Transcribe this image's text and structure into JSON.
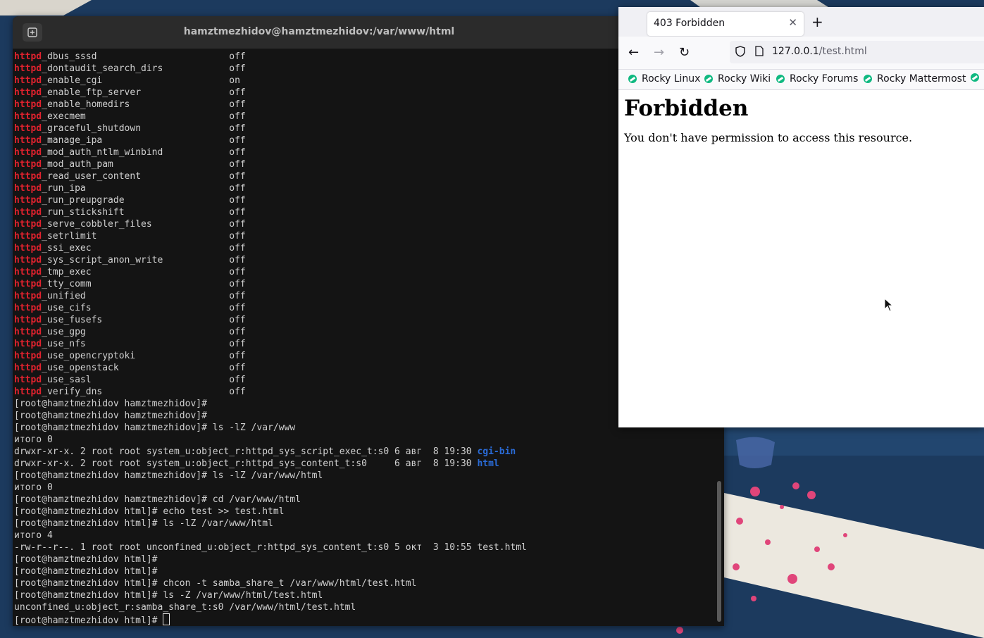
{
  "terminal": {
    "title": "hamztmezhidov@hamztmezhidov:/var/www/html",
    "lines": [
      [
        {
          "t": "httpd",
          "c": "red"
        },
        {
          "t": "_dbus_sssd                        off"
        }
      ],
      [
        {
          "t": "httpd",
          "c": "red"
        },
        {
          "t": "_dontaudit_search_dirs            off"
        }
      ],
      [
        {
          "t": "httpd",
          "c": "red"
        },
        {
          "t": "_enable_cgi                       on"
        }
      ],
      [
        {
          "t": "httpd",
          "c": "red"
        },
        {
          "t": "_enable_ftp_server                off"
        }
      ],
      [
        {
          "t": "httpd",
          "c": "red"
        },
        {
          "t": "_enable_homedirs                  off"
        }
      ],
      [
        {
          "t": "httpd",
          "c": "red"
        },
        {
          "t": "_execmem                          off"
        }
      ],
      [
        {
          "t": "httpd",
          "c": "red"
        },
        {
          "t": "_graceful_shutdown                off"
        }
      ],
      [
        {
          "t": "httpd",
          "c": "red"
        },
        {
          "t": "_manage_ipa                       off"
        }
      ],
      [
        {
          "t": "httpd",
          "c": "red"
        },
        {
          "t": "_mod_auth_ntlm_winbind            off"
        }
      ],
      [
        {
          "t": "httpd",
          "c": "red"
        },
        {
          "t": "_mod_auth_pam                     off"
        }
      ],
      [
        {
          "t": "httpd",
          "c": "red"
        },
        {
          "t": "_read_user_content                off"
        }
      ],
      [
        {
          "t": "httpd",
          "c": "red"
        },
        {
          "t": "_run_ipa                          off"
        }
      ],
      [
        {
          "t": "httpd",
          "c": "red"
        },
        {
          "t": "_run_preupgrade                   off"
        }
      ],
      [
        {
          "t": "httpd",
          "c": "red"
        },
        {
          "t": "_run_stickshift                   off"
        }
      ],
      [
        {
          "t": "httpd",
          "c": "red"
        },
        {
          "t": "_serve_cobbler_files              off"
        }
      ],
      [
        {
          "t": "httpd",
          "c": "red"
        },
        {
          "t": "_setrlimit                        off"
        }
      ],
      [
        {
          "t": "httpd",
          "c": "red"
        },
        {
          "t": "_ssi_exec                         off"
        }
      ],
      [
        {
          "t": "httpd",
          "c": "red"
        },
        {
          "t": "_sys_script_anon_write            off"
        }
      ],
      [
        {
          "t": "httpd",
          "c": "red"
        },
        {
          "t": "_tmp_exec                         off"
        }
      ],
      [
        {
          "t": "httpd",
          "c": "red"
        },
        {
          "t": "_tty_comm                         off"
        }
      ],
      [
        {
          "t": "httpd",
          "c": "red"
        },
        {
          "t": "_unified                          off"
        }
      ],
      [
        {
          "t": "httpd",
          "c": "red"
        },
        {
          "t": "_use_cifs                         off"
        }
      ],
      [
        {
          "t": "httpd",
          "c": "red"
        },
        {
          "t": "_use_fusefs                       off"
        }
      ],
      [
        {
          "t": "httpd",
          "c": "red"
        },
        {
          "t": "_use_gpg                          off"
        }
      ],
      [
        {
          "t": "httpd",
          "c": "red"
        },
        {
          "t": "_use_nfs                          off"
        }
      ],
      [
        {
          "t": "httpd",
          "c": "red"
        },
        {
          "t": "_use_opencryptoki                 off"
        }
      ],
      [
        {
          "t": "httpd",
          "c": "red"
        },
        {
          "t": "_use_openstack                    off"
        }
      ],
      [
        {
          "t": "httpd",
          "c": "red"
        },
        {
          "t": "_use_sasl                         off"
        }
      ],
      [
        {
          "t": "httpd",
          "c": "red"
        },
        {
          "t": "_verify_dns                       off"
        }
      ],
      [
        {
          "t": "[root@hamztmezhidov hamztmezhidov]#"
        }
      ],
      [
        {
          "t": "[root@hamztmezhidov hamztmezhidov]#"
        }
      ],
      [
        {
          "t": "[root@hamztmezhidov hamztmezhidov]# ls -lZ /var/www"
        }
      ],
      [
        {
          "t": "итого 0"
        }
      ],
      [
        {
          "t": "drwxr-xr-x. 2 root root system_u:object_r:httpd_sys_script_exec_t:s0 6 авг  8 19:30 "
        },
        {
          "t": "cgi-bin",
          "c": "blue"
        }
      ],
      [
        {
          "t": "drwxr-xr-x. 2 root root system_u:object_r:httpd_sys_content_t:s0     6 авг  8 19:30 "
        },
        {
          "t": "html",
          "c": "blue"
        }
      ],
      [
        {
          "t": "[root@hamztmezhidov hamztmezhidov]# ls -lZ /var/www/html"
        }
      ],
      [
        {
          "t": "итого 0"
        }
      ],
      [
        {
          "t": "[root@hamztmezhidov hamztmezhidov]# cd /var/www/html"
        }
      ],
      [
        {
          "t": "[root@hamztmezhidov html]# echo test >> test.html"
        }
      ],
      [
        {
          "t": "[root@hamztmezhidov html]# ls -lZ /var/www/html"
        }
      ],
      [
        {
          "t": "итого 4"
        }
      ],
      [
        {
          "t": "-rw-r--r--. 1 root root unconfined_u:object_r:httpd_sys_content_t:s0 5 окт  3 10:55 test.html"
        }
      ],
      [
        {
          "t": "[root@hamztmezhidov html]#"
        }
      ],
      [
        {
          "t": "[root@hamztmezhidov html]#"
        }
      ],
      [
        {
          "t": "[root@hamztmezhidov html]# chcon -t samba_share_t /var/www/html/test.html"
        }
      ],
      [
        {
          "t": "[root@hamztmezhidov html]# ls -Z /var/www/html/test.html"
        }
      ],
      [
        {
          "t": "unconfined_u:object_r:samba_share_t:s0 /var/www/html/test.html"
        }
      ],
      [
        {
          "t": "[root@hamztmezhidov html]# "
        },
        {
          "t": "",
          "c": "cursor"
        }
      ]
    ]
  },
  "browser": {
    "tab_title": "403 Forbidden",
    "url_host": "127.0.0.1",
    "url_path": "/test.html",
    "bookmarks": [
      "Rocky Linux",
      "Rocky Wiki",
      "Rocky Forums",
      "Rocky Mattermost"
    ],
    "page_heading": "Forbidden",
    "page_message": "You don't have permission to access this resource."
  },
  "colors": {
    "terminal_bg": "#141414",
    "httpd_red": "#e0222e",
    "dir_blue": "#2a6bd6",
    "wallpaper_navy": "#1c3a5e",
    "rocky_green": "#10b981"
  }
}
